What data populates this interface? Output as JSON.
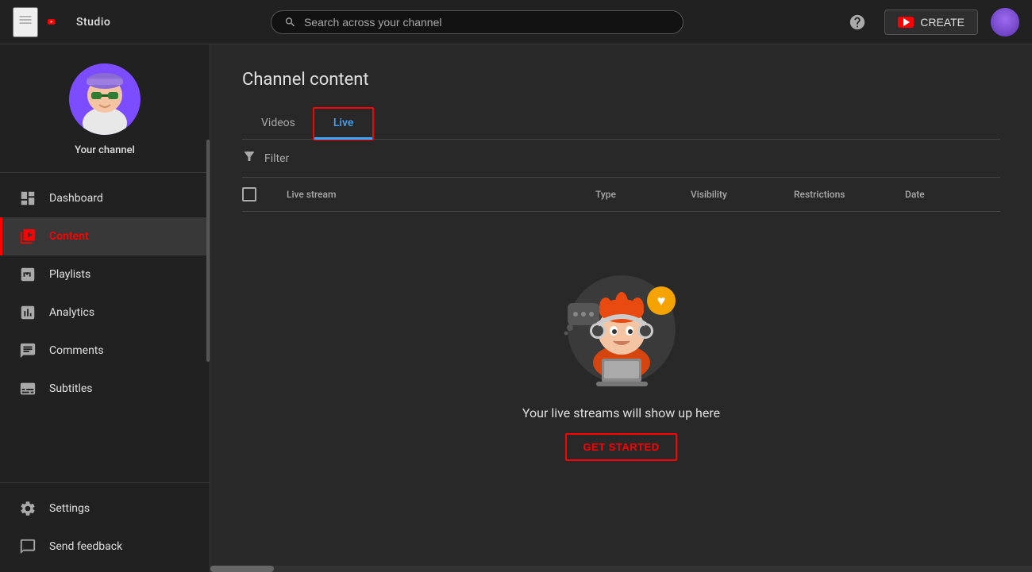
{
  "topnav": {
    "logo_text": "Studio",
    "search_placeholder": "Search across your channel",
    "create_label": "CREATE",
    "help_icon": "help-circle-icon"
  },
  "sidebar": {
    "channel_name": "Your channel",
    "nav_items": [
      {
        "id": "dashboard",
        "label": "Dashboard",
        "icon": "dashboard-icon"
      },
      {
        "id": "content",
        "label": "Content",
        "icon": "content-icon",
        "active": true
      },
      {
        "id": "playlists",
        "label": "Playlists",
        "icon": "playlists-icon"
      },
      {
        "id": "analytics",
        "label": "Analytics",
        "icon": "analytics-icon"
      },
      {
        "id": "comments",
        "label": "Comments",
        "icon": "comments-icon"
      },
      {
        "id": "subtitles",
        "label": "Subtitles",
        "icon": "subtitles-icon"
      }
    ],
    "bottom_items": [
      {
        "id": "settings",
        "label": "Settings",
        "icon": "settings-icon"
      },
      {
        "id": "send-feedback",
        "label": "Send feedback",
        "icon": "feedback-icon"
      }
    ]
  },
  "main": {
    "page_title": "Channel content",
    "tabs": [
      {
        "id": "videos",
        "label": "Videos",
        "active": false
      },
      {
        "id": "live",
        "label": "Live",
        "active": true
      }
    ],
    "filter_label": "Filter",
    "table": {
      "columns": [
        {
          "id": "live-stream",
          "label": "Live stream"
        },
        {
          "id": "type",
          "label": "Type"
        },
        {
          "id": "visibility",
          "label": "Visibility"
        },
        {
          "id": "restrictions",
          "label": "Restrictions"
        },
        {
          "id": "date",
          "label": "Date"
        }
      ]
    },
    "empty_state": {
      "message": "Your live streams will show up here",
      "cta_label": "GET STARTED"
    }
  }
}
